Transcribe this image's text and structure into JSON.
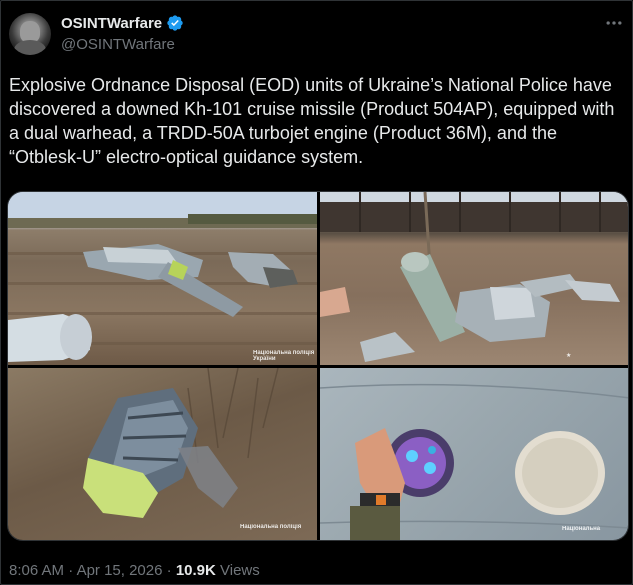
{
  "author": {
    "display_name": "OSINTWarfare",
    "handle": "@OSINTWarfare",
    "verified": true
  },
  "post": {
    "text": "Explosive Ordnance Disposal (EOD) units of Ukraine’s National Police have discovered a downed Kh-101 cruise missile (Product 504AP), equipped with a dual warhead, a TRDD-50A turbojet engine (Product 36M), and the “Otblesk-U” electro-optical guidance system.",
    "time": "8:06 AM",
    "separator": "·",
    "date": "Apr 15, 2026",
    "views_count": "10.9K",
    "views_label": "Views"
  },
  "media": {
    "watermark_1": "Національна поліція України",
    "watermark_2": "Національна поліція",
    "watermark_4": "Національна"
  },
  "icons": {
    "verified": "verified-badge-icon",
    "more": "more-options-icon"
  },
  "colors": {
    "accent": "#1d9bf0",
    "text": "#e7e9ea",
    "muted": "#71767b",
    "background": "#000000"
  }
}
